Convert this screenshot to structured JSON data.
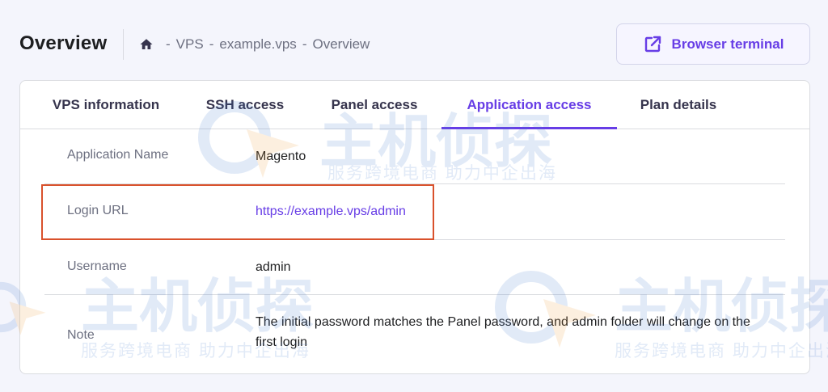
{
  "header": {
    "title": "Overview",
    "breadcrumb": [
      "VPS",
      "example.vps",
      "Overview"
    ],
    "breadcrumb_separator": "-",
    "terminal_button": "Browser terminal"
  },
  "tabs": [
    {
      "label": "VPS information",
      "active": false
    },
    {
      "label": "SSH access",
      "active": false
    },
    {
      "label": "Panel access",
      "active": false
    },
    {
      "label": "Application access",
      "active": true
    },
    {
      "label": "Plan details",
      "active": false
    }
  ],
  "details": {
    "app_name_label": "Application Name",
    "app_name_value": "Magento",
    "login_url_label": "Login URL",
    "login_url_value": "https://example.vps/admin",
    "username_label": "Username",
    "username_value": "admin",
    "note_label": "Note",
    "note_value": "The initial password matches the Panel password, and admin folder will change on the first login"
  },
  "watermark": {
    "brand": "主机侦探",
    "tagline": "服务跨境电商 助力中企出海"
  },
  "colors": {
    "accent": "#673de6",
    "highlight": "#d9512c",
    "background": "#f4f5fc"
  },
  "icons": [
    "home-icon",
    "external-link-icon"
  ]
}
